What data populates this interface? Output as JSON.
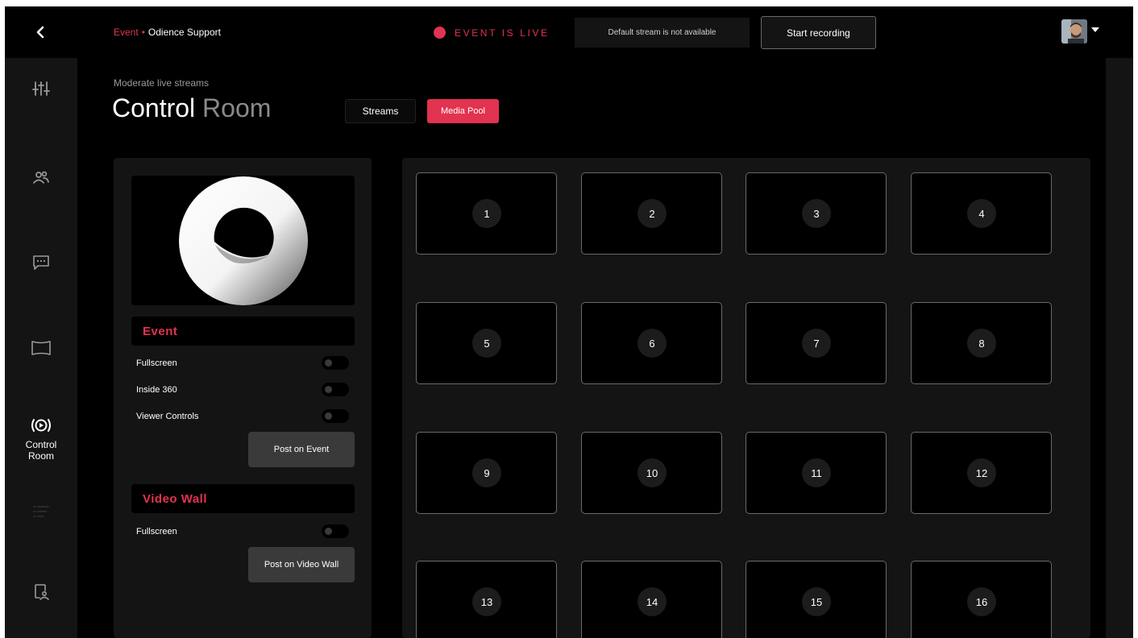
{
  "header": {
    "breadcrumb_parent": "Event",
    "breadcrumb_separator": "•",
    "breadcrumb_current": "Odience Support",
    "live_status": "EVENT IS LIVE",
    "stream_status": "Default stream is not available",
    "record_label": "Start recording"
  },
  "sidebar": {
    "items": [
      {
        "icon": "sliders-icon",
        "label": ""
      },
      {
        "icon": "users-icon",
        "label": ""
      },
      {
        "icon": "chat-icon",
        "label": ""
      },
      {
        "icon": "screen-icon",
        "label": ""
      },
      {
        "icon": "control-room-icon",
        "label": "Control Room",
        "active": true
      },
      {
        "icon": "list-icon",
        "label": ""
      },
      {
        "icon": "device-user-icon",
        "label": ""
      }
    ]
  },
  "page": {
    "subtitle": "Moderate live streams",
    "title_primary": "Control",
    "title_secondary": "Room",
    "tabs": [
      {
        "label": "Streams",
        "active": false
      },
      {
        "label": "Media Pool",
        "active": true
      }
    ]
  },
  "event_panel": {
    "heading": "Event",
    "options": [
      {
        "label": "Fullscreen",
        "on": false
      },
      {
        "label": "Inside 360",
        "on": false
      },
      {
        "label": "Viewer Controls",
        "on": false
      }
    ],
    "post_label": "Post on Event"
  },
  "video_wall_panel": {
    "heading": "Video Wall",
    "options": [
      {
        "label": "Fullscreen",
        "on": false
      }
    ],
    "post_label": "Post on Video Wall"
  },
  "media_slots": [
    "1",
    "2",
    "3",
    "4",
    "5",
    "6",
    "7",
    "8",
    "9",
    "10",
    "11",
    "12",
    "13",
    "14",
    "15",
    "16"
  ],
  "colors": {
    "accent": "#e23350",
    "panel": "#141414",
    "background": "#000000"
  }
}
